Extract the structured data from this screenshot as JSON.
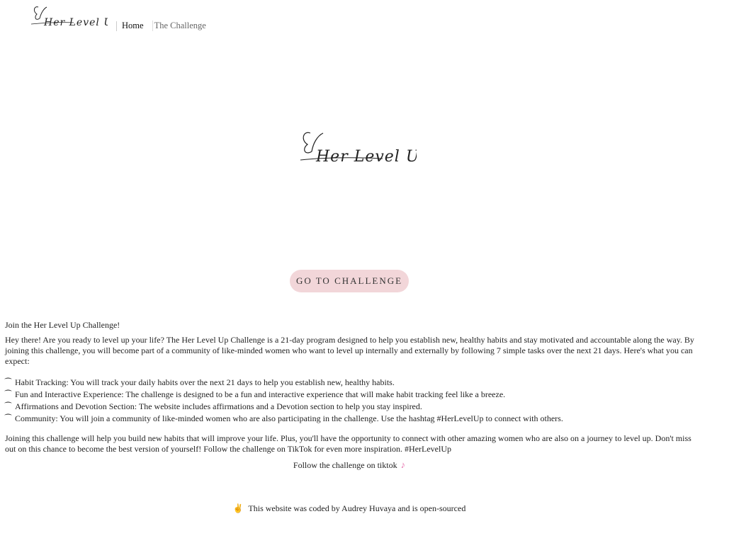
{
  "nav": {
    "logo_text": "Her Level Up",
    "links": [
      {
        "label": "Home",
        "active": true
      },
      {
        "label": "The Challenge",
        "active": false
      }
    ]
  },
  "hero": {
    "logo_text": "Her Level Up",
    "cta_label": "GO TO CHALLENGE"
  },
  "content": {
    "title": "Join the Her Level Up Challenge!",
    "intro": "Hey there! Are you ready to level up your life? The Her Level Up Challenge is a 21-day program designed to help you establish new, healthy habits and stay motivated and accountable along the way. By joining this challenge, you will become part of a community of like-minded women who want to level up internally and externally by following 7 simple tasks over the next 21 days. Here's what you can expect:",
    "bullet_glyph": "⁀",
    "features": [
      "Habit Tracking: You will track your daily habits over the next 21 days to help you establish new, healthy habits.",
      "Fun and Interactive Experience: The challenge is designed to be a fun and interactive experience that will make habit tracking feel like a breeze.",
      "Affirmations and Devotion Section: The website includes affirmations and a Devotion section to help you stay inspired.",
      "Community: You will join a community of like-minded women who are also participating in the challenge. Use the hashtag #HerLevelUp to connect with others."
    ],
    "closing": "Joining this challenge will help you build new habits that will improve your life. Plus, you'll have the opportunity to connect with other amazing women who are also on a journey to level up. Don't miss out on this chance to become the best version of yourself! Follow the challenge on TikTok for even more inspiration. #HerLevelUp"
  },
  "tiktok": {
    "text": "Follow the challenge on tiktok",
    "icon": "music-note-icon",
    "icon_glyph": "♪",
    "icon_color": "#e875b0"
  },
  "footer": {
    "icon": "victory-hand-icon",
    "icon_glyph": "✌",
    "text": "This website was coded by Audrey Huvaya and is open-sourced"
  },
  "colors": {
    "cta_background": "#f2d6d9",
    "text": "#222222"
  }
}
